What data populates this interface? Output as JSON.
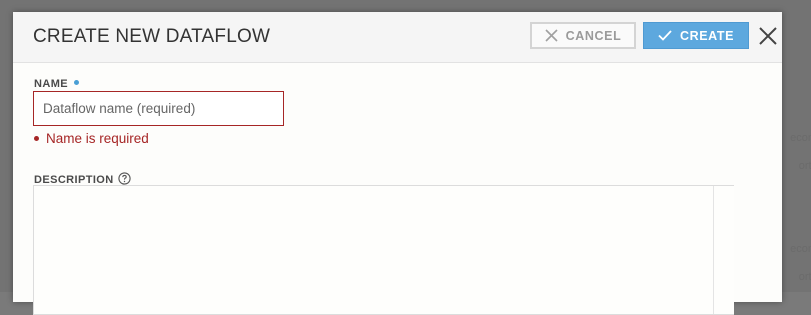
{
  "dialog": {
    "title": "CREATE NEW DATAFLOW",
    "cancel_label": "CANCEL",
    "create_label": "CREATE"
  },
  "form": {
    "name_label": "NAME",
    "name_placeholder": "Dataflow name (required)",
    "name_value": "",
    "name_error": "Name is required",
    "description_label": "DESCRIPTION",
    "description_value": ""
  },
  "icons": {
    "cancel": "x-icon",
    "create": "check-icon",
    "close": "close-icon",
    "help": "help-circle-icon",
    "required": "required-dot-icon"
  },
  "colors": {
    "accent": "#5da8de",
    "error": "#a62626",
    "required_dot": "#4a9fd5"
  }
}
